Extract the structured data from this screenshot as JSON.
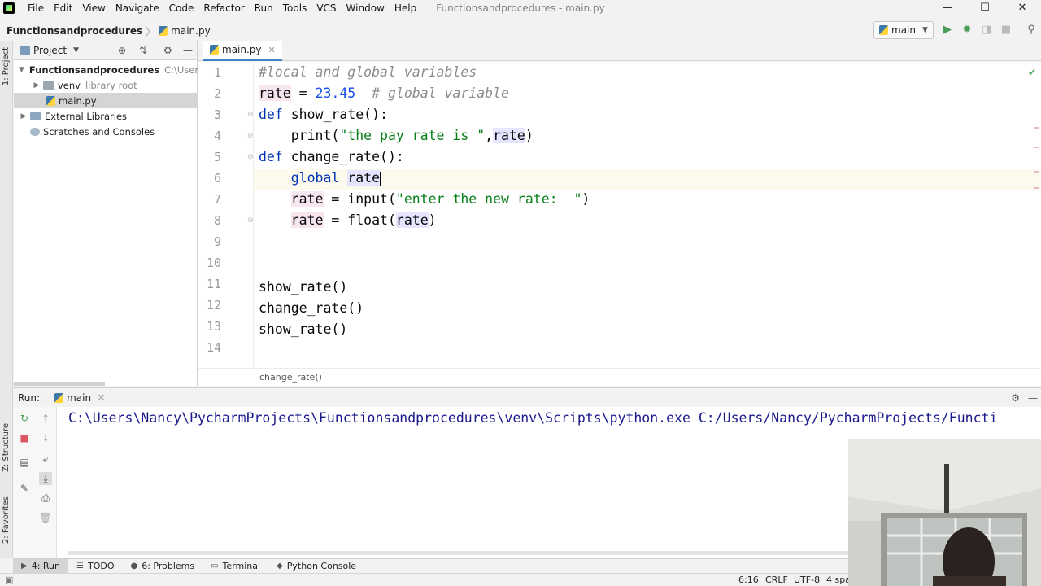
{
  "window": {
    "title": "Functionsandprocedures - main.py",
    "menu": [
      "File",
      "Edit",
      "View",
      "Navigate",
      "Code",
      "Refactor",
      "Run",
      "Tools",
      "VCS",
      "Window",
      "Help"
    ],
    "controls": {
      "minimize": "—",
      "maximize": "☐",
      "close": "✕"
    }
  },
  "navbar": {
    "project": "Functionsandprocedures",
    "file": "main.py",
    "run_config": "main"
  },
  "left_stripe": {
    "project": "1: Project",
    "structure": "Z: Structure",
    "favorites": "2: Favorites"
  },
  "project_panel": {
    "title": "Project",
    "tree": [
      {
        "label": "Functionsandprocedures",
        "hint": "C:\\Users\\N..."
      },
      {
        "label": "venv",
        "hint": "library root"
      },
      {
        "label": "main.py"
      },
      {
        "label": "External Libraries"
      },
      {
        "label": "Scratches and Consoles"
      }
    ]
  },
  "editor": {
    "tab": "main.py",
    "line_numbers": [
      "1",
      "2",
      "3",
      "4",
      "5",
      "6",
      "7",
      "8",
      "9",
      "10",
      "11",
      "12",
      "13",
      "14"
    ],
    "code": {
      "l1_comment": "#local and global variables",
      "l2_var": "rate",
      "l2_eq": " = ",
      "l2_num": "23.45",
      "l2_comment": "  # global variable",
      "l3_kw": "def",
      "l3_rest": " show_rate():",
      "l4_fn": "    print(",
      "l4_str": "\"the pay rate is \"",
      "l4_comma": ",",
      "l4_var": "rate",
      "l4_end": ")",
      "l5_kw": "def",
      "l5_rest": " change_rate():",
      "l6_kw": "    global ",
      "l6_var": "rate",
      "l7_indent": "    ",
      "l7_var": "rate",
      "l7_mid": " = input(",
      "l7_str": "\"enter the new rate:  \"",
      "l7_end": ")",
      "l8_indent": "    ",
      "l8_var": "rate",
      "l8_mid": " = float(",
      "l8_var2": "rate",
      "l8_end": ")",
      "l11": "show_rate()",
      "l12": "change_rate()",
      "l13": "show_rate()"
    },
    "breadcrumb": "change_rate()"
  },
  "run_panel": {
    "label": "Run:",
    "tab": "main",
    "output": "C:\\Users\\Nancy\\PycharmProjects\\Functionsandprocedures\\venv\\Scripts\\python.exe C:/Users/Nancy/PycharmProjects/Functi"
  },
  "tool_windows": [
    {
      "key": "4: Run",
      "glyph": "▶"
    },
    {
      "key": "TODO",
      "glyph": "☰"
    },
    {
      "key": "6: Problems",
      "glyph": "●"
    },
    {
      "key": "Terminal",
      "glyph": "▭"
    },
    {
      "key": "Python Console",
      "glyph": "◆"
    }
  ],
  "status": {
    "position": "6:16",
    "line_sep": "CRLF",
    "encoding": "UTF-8",
    "indent": "4 spa"
  },
  "colors": {
    "accent": "#4083c9",
    "keyword": "#0033b3",
    "string": "#067d17",
    "number": "#1750eb",
    "comment": "#8c8c8c",
    "run_green": "#499c54",
    "stop_red": "#db5860"
  }
}
